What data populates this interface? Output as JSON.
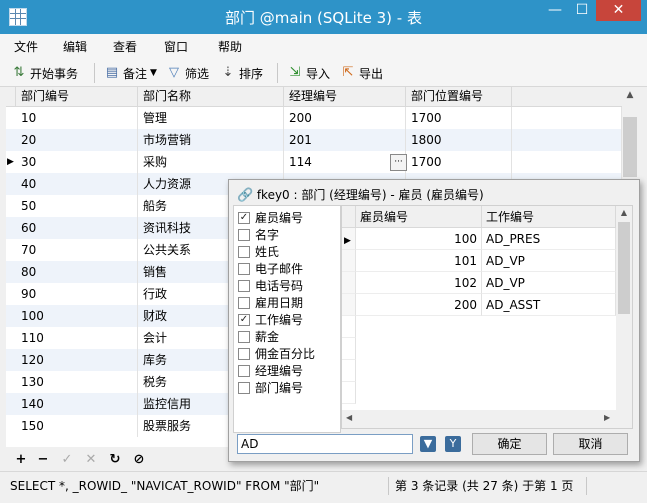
{
  "window": {
    "title": "部门 @main (SQLite 3) - 表",
    "controls": [
      "—",
      "☐",
      "✕"
    ]
  },
  "menu": [
    "文件",
    "编辑",
    "查看",
    "窗口",
    "帮助"
  ],
  "toolbar": {
    "begin_transaction": "开始事务",
    "note": "备注",
    "filter": "筛选",
    "sort": "排序",
    "import": "导入",
    "export": "导出"
  },
  "grid": {
    "columns": [
      "部门编号",
      "部门名称",
      "经理编号",
      "部门位置编号"
    ],
    "rows": [
      [
        "10",
        "管理",
        "200",
        "1700"
      ],
      [
        "20",
        "市场营销",
        "201",
        "1800"
      ],
      [
        "30",
        "采购",
        "114",
        "1700"
      ],
      [
        "40",
        "人力资源",
        "",
        ""
      ],
      [
        "50",
        "船务",
        "",
        ""
      ],
      [
        "60",
        "资讯科技",
        "",
        ""
      ],
      [
        "70",
        "公共关系",
        "",
        ""
      ],
      [
        "80",
        "销售",
        "",
        ""
      ],
      [
        "90",
        "行政",
        "",
        ""
      ],
      [
        "100",
        "财政",
        "",
        ""
      ],
      [
        "110",
        "会计",
        "",
        ""
      ],
      [
        "120",
        "库务",
        "",
        ""
      ],
      [
        "130",
        "税务",
        "",
        ""
      ],
      [
        "140",
        "监控信用",
        "",
        ""
      ],
      [
        "150",
        "股票服务",
        "",
        ""
      ]
    ],
    "ellipsis": "···"
  },
  "popup": {
    "title": "fkey0 : 部门 (经理编号) - 雇员 (雇员编号)",
    "fields": [
      {
        "label": "雇员编号",
        "checked": true
      },
      {
        "label": "名字",
        "checked": false
      },
      {
        "label": "姓氏",
        "checked": false
      },
      {
        "label": "电子邮件",
        "checked": false
      },
      {
        "label": "电话号码",
        "checked": false
      },
      {
        "label": "雇用日期",
        "checked": false
      },
      {
        "label": "工作编号",
        "checked": true
      },
      {
        "label": "薪金",
        "checked": false
      },
      {
        "label": "佣金百分比",
        "checked": false
      },
      {
        "label": "经理编号",
        "checked": false
      },
      {
        "label": "部门编号",
        "checked": false
      }
    ],
    "columns": [
      "雇员编号",
      "工作编号"
    ],
    "rows": [
      [
        "100",
        "AD_PRES"
      ],
      [
        "101",
        "AD_VP"
      ],
      [
        "102",
        "AD_VP"
      ],
      [
        "200",
        "AD_ASST"
      ]
    ],
    "search_value": "AD",
    "ok_label": "确定",
    "cancel_label": "取消"
  },
  "status": {
    "sql": "SELECT *, _ROWID_ \"NAVICAT_ROWID\" FROM \"部门\"",
    "record": "第 3 条记录 (共 27 条) 于第 1 页"
  },
  "colors": {
    "titlebar": "#2e93c8",
    "close": "#c7453b",
    "row_alt": "#eef3fa",
    "selected_row_marker": "#000000"
  }
}
